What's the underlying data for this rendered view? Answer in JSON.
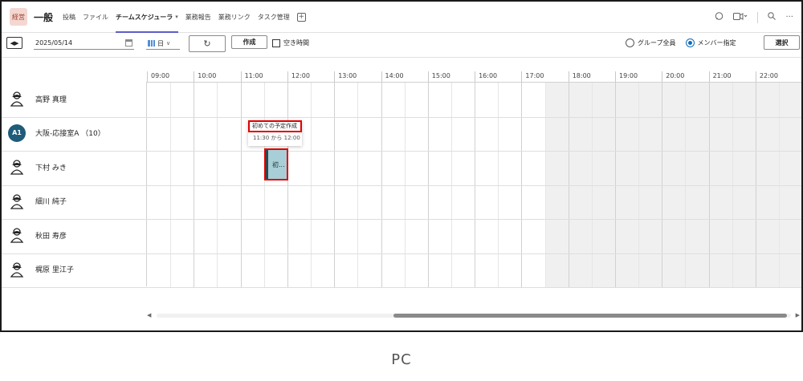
{
  "header": {
    "team_badge": "経営",
    "channel": "一般",
    "tabs": [
      {
        "label": "投稿"
      },
      {
        "label": "ファイル"
      },
      {
        "label": "チームスケジューラ",
        "active": true
      },
      {
        "label": "業務報告"
      },
      {
        "label": "業務リンク"
      },
      {
        "label": "タスク管理"
      }
    ],
    "add_tab": "+",
    "right_icons": [
      "chat-icon",
      "video-icon",
      "search-icon",
      "more-icon"
    ],
    "more": "···"
  },
  "toolbar": {
    "nav": "◀▶",
    "date": "2025/05/14",
    "view": "日",
    "create": "作成",
    "free_time": "空き時間",
    "radio_all": "グループ全員",
    "radio_member": "メンバー指定",
    "select": "選択"
  },
  "schedule": {
    "hours": [
      "09:00",
      "10:00",
      "11:00",
      "12:00",
      "13:00",
      "14:00",
      "15:00",
      "16:00",
      "17:00",
      "18:00",
      "19:00",
      "20:00",
      "21:00",
      "22:00"
    ],
    "members": [
      {
        "name": "高野 真理",
        "avatar": "person-avatar-icon"
      },
      {
        "name": "大阪-応接室A （10）",
        "avatar": "initials-avatar",
        "initials": "A1"
      },
      {
        "name": "下村 みき",
        "avatar": "person-avatar-icon"
      },
      {
        "name": "細川 純子",
        "avatar": "person-avatar-icon"
      },
      {
        "name": "秋田 寿彦",
        "avatar": "person-avatar-icon"
      },
      {
        "name": "梶原 里江子",
        "avatar": "person-avatar-icon"
      }
    ],
    "event": {
      "label": "初...",
      "member_index": 2,
      "start": "11:30",
      "end": "12:00"
    },
    "tooltip": {
      "title": "初めての予定作成",
      "time": "11:30 から 12:00"
    }
  },
  "colors": {
    "accent": "#5b5fc7",
    "event": "#a8cfd7",
    "highlight": "#e00000",
    "radio": "#0f6cbd"
  },
  "caption": "PC"
}
